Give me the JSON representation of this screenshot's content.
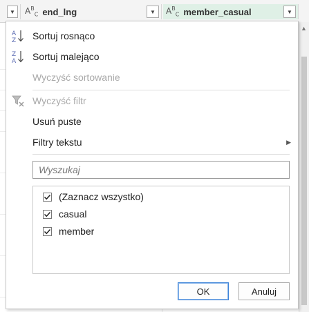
{
  "columns": [
    {
      "name": "end_lng",
      "type_icon": "ABC"
    },
    {
      "name": "member_casual",
      "type_icon": "ABC"
    }
  ],
  "menu": {
    "sort_asc": "Sortuj rosnąco",
    "sort_desc": "Sortuj malejąco",
    "clear_sort": "Wyczyść sortowanie",
    "clear_filter": "Wyczyść filtr",
    "remove_empty": "Usuń puste",
    "text_filters": "Filtry tekstu"
  },
  "search": {
    "placeholder": "Wyszukaj",
    "value": ""
  },
  "filter_values": [
    {
      "label": "(Zaznacz wszystko)",
      "checked": true
    },
    {
      "label": "casual",
      "checked": true
    },
    {
      "label": "member",
      "checked": true
    }
  ],
  "buttons": {
    "ok": "OK",
    "cancel": "Anuluj"
  },
  "colors": {
    "accent": "#3c83d8",
    "sort_icon": "#5b6bb3",
    "highlight": "#dff0e6"
  }
}
